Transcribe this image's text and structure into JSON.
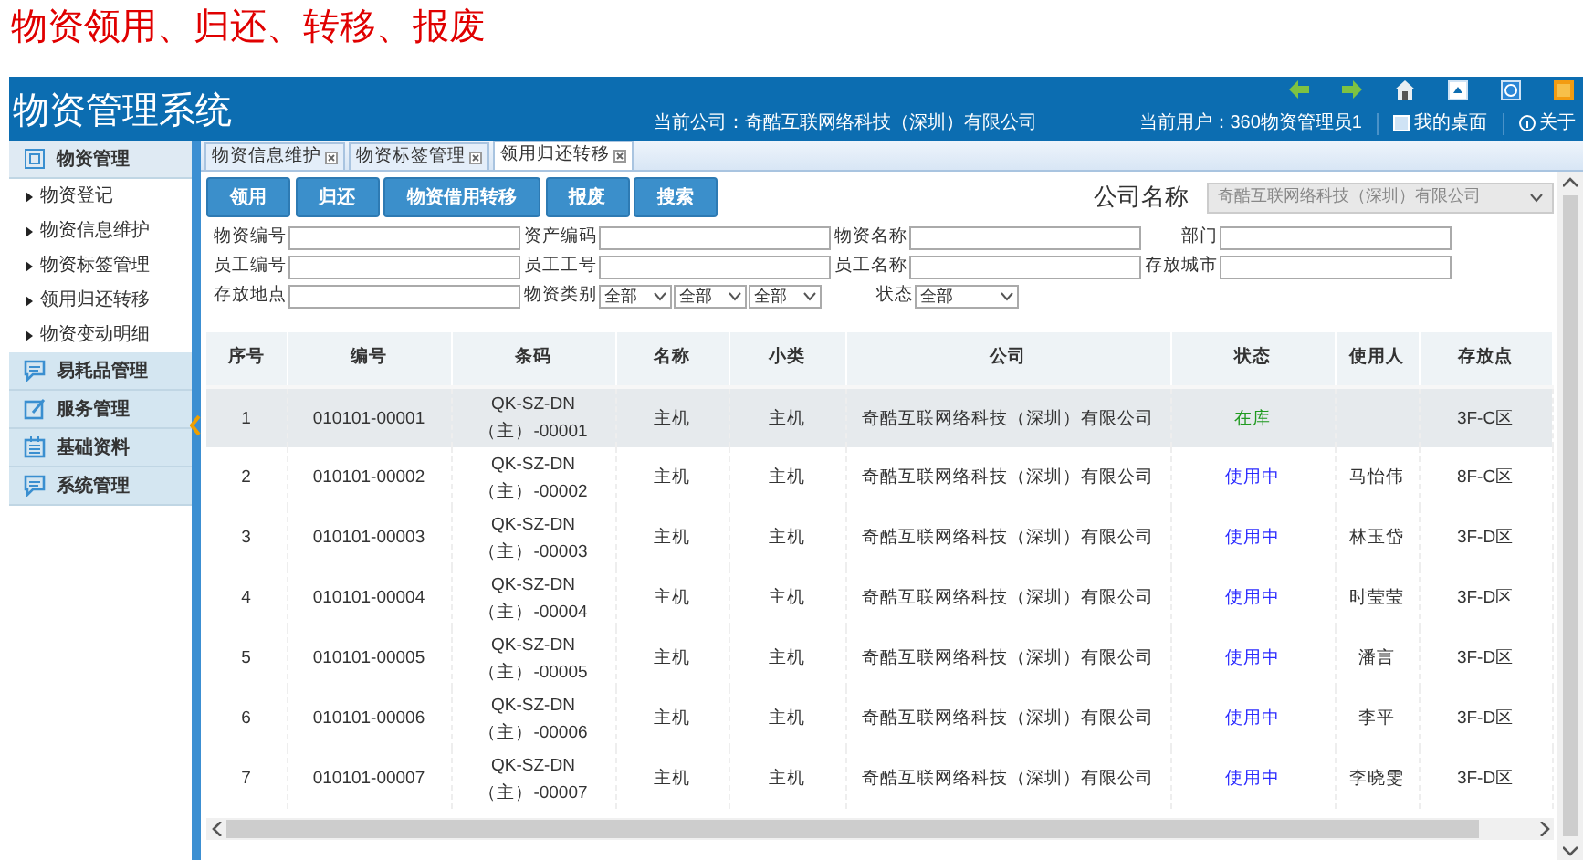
{
  "page_title": "物资领用、归还、转移、报废",
  "header": {
    "title": "物资管理系统",
    "company": "当前公司：奇酷互联网络科技（深圳）有限公司",
    "user": "当前用户：360物资管理员1",
    "links": [
      "我的桌面",
      "关于"
    ]
  },
  "sidebar": [
    {
      "label": "物资管理",
      "children": [
        "物资登记",
        "物资信息维护",
        "物资标签管理",
        "领用归还转移",
        "物资变动明细"
      ]
    },
    {
      "label": "易耗品管理"
    },
    {
      "label": "服务管理"
    },
    {
      "label": "基础资料"
    },
    {
      "label": "系统管理"
    }
  ],
  "tabs": [
    {
      "label": "物资信息维护",
      "selected": false
    },
    {
      "label": "物资标签管理",
      "selected": false
    },
    {
      "label": "领用归还转移",
      "selected": true
    }
  ],
  "actions": [
    "领用",
    "归还",
    "物资借用转移",
    "报废",
    "搜索"
  ],
  "company_select": {
    "label": "公司名称",
    "value": "奇酷互联网络科技（深圳）有限公司"
  },
  "filters": [
    [
      {
        "label": "物资编号",
        "kind": "text"
      },
      {
        "label": "资产编码",
        "kind": "text"
      },
      {
        "label": "物资名称",
        "kind": "text"
      },
      {
        "label": "部门",
        "kind": "text"
      }
    ],
    [
      {
        "label": "员工编号",
        "kind": "text"
      },
      {
        "label": "员工工号",
        "kind": "text"
      },
      {
        "label": "员工名称",
        "kind": "text"
      },
      {
        "label": "存放城市",
        "kind": "text"
      }
    ],
    [
      {
        "label": "存放地点",
        "kind": "text"
      },
      {
        "label": "物资类别",
        "kind": "select",
        "values": [
          "全部",
          "全部",
          "全部"
        ]
      },
      {
        "label": "状态",
        "kind": "select",
        "values": [
          "全部"
        ]
      }
    ]
  ],
  "table": {
    "columns": [
      "序号",
      "编号",
      "条码",
      "名称",
      "小类",
      "公司",
      "状态",
      "使用人",
      "存放点"
    ],
    "rows": [
      {
        "selected": true,
        "cells": [
          "1",
          "010101-00001",
          "QK-SZ-DN（主）-00001",
          "主机",
          "主机",
          "奇酷互联网络科技（深圳）有限公司"
        ],
        "status": {
          "text": "在库",
          "color": "#1f9a1f"
        },
        "user": "",
        "location": "3F-C区"
      },
      {
        "selected": false,
        "cells": [
          "2",
          "010101-00002",
          "QK-SZ-DN（主）-00002",
          "主机",
          "主机",
          "奇酷互联网络科技（深圳）有限公司"
        ],
        "status": {
          "text": "使用中",
          "color": "#2b2bff"
        },
        "user": "马怡伟",
        "location": "8F-C区"
      },
      {
        "selected": false,
        "cells": [
          "3",
          "010101-00003",
          "QK-SZ-DN（主）-00003",
          "主机",
          "主机",
          "奇酷互联网络科技（深圳）有限公司"
        ],
        "status": {
          "text": "使用中",
          "color": "#2b2bff"
        },
        "user": "林玉岱",
        "location": "3F-D区"
      },
      {
        "selected": false,
        "cells": [
          "4",
          "010101-00004",
          "QK-SZ-DN（主）-00004",
          "主机",
          "主机",
          "奇酷互联网络科技（深圳）有限公司"
        ],
        "status": {
          "text": "使用中",
          "color": "#2b2bff"
        },
        "user": "时莹莹",
        "location": "3F-D区"
      },
      {
        "selected": false,
        "cells": [
          "5",
          "010101-00005",
          "QK-SZ-DN（主）-00005",
          "主机",
          "主机",
          "奇酷互联网络科技（深圳）有限公司"
        ],
        "status": {
          "text": "使用中",
          "color": "#2b2bff"
        },
        "user": "潘言",
        "location": "3F-D区"
      },
      {
        "selected": false,
        "cells": [
          "6",
          "010101-00006",
          "QK-SZ-DN（主）-00006",
          "主机",
          "主机",
          "奇酷互联网络科技（深圳）有限公司"
        ],
        "status": {
          "text": "使用中",
          "color": "#2b2bff"
        },
        "user": "李平",
        "location": "3F-D区"
      },
      {
        "selected": false,
        "cells": [
          "7",
          "010101-00007",
          "QK-SZ-DN（主）-00007",
          "主机",
          "主机",
          "奇酷互联网络科技（深圳）有限公司"
        ],
        "status": {
          "text": "使用中",
          "color": "#2b2bff"
        },
        "user": "李晓雯",
        "location": "3F-D区"
      }
    ]
  }
}
